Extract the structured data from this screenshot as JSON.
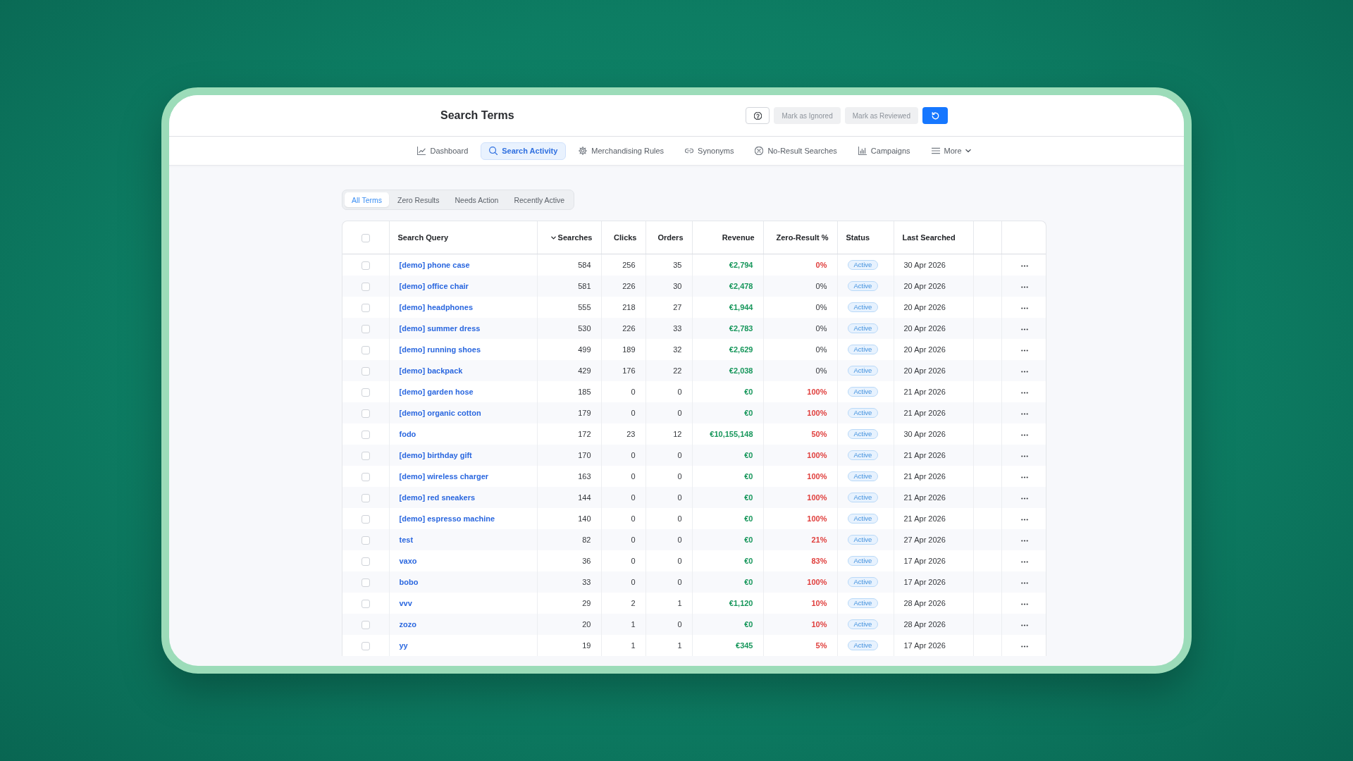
{
  "header": {
    "title": "Search Terms",
    "actions": [
      {
        "label": "Mark as Ignored",
        "disabled": true
      },
      {
        "label": "Mark as Reviewed",
        "disabled": true
      }
    ]
  },
  "nav": {
    "tabs": [
      {
        "label": "Dashboard",
        "selected": false
      },
      {
        "label": "Search Activity",
        "selected": true
      },
      {
        "label": "Merchandising Rules",
        "selected": false
      },
      {
        "label": "Synonyms",
        "selected": false
      },
      {
        "label": "No-Result Searches",
        "selected": false
      },
      {
        "label": "Campaigns",
        "selected": false
      }
    ],
    "more_menu": {
      "label": "More"
    }
  },
  "filters": [
    {
      "label": "All Terms",
      "selected": true
    },
    {
      "label": "Zero Results",
      "selected": false
    },
    {
      "label": "Needs Action",
      "selected": false
    },
    {
      "label": "Recently Active",
      "selected": false
    }
  ],
  "table": {
    "select_all": {
      "checked": false
    },
    "columns": [
      {
        "label": "Search Query",
        "sorted": false
      },
      {
        "label": "Searches",
        "sorted": true
      },
      {
        "label": "Clicks",
        "sorted": false
      },
      {
        "label": "Orders",
        "sorted": false
      },
      {
        "label": "Revenue",
        "sorted": false
      },
      {
        "label": "Zero-Result %",
        "sorted": false
      },
      {
        "label": "Status",
        "sorted": false
      },
      {
        "label": "Last Searched",
        "sorted": false
      }
    ],
    "rows": [
      {
        "checked": false,
        "query": "[demo] phone case",
        "searches": "584",
        "clicks": "256",
        "orders": "35",
        "revenue": "€2,794",
        "zero_result": "0%",
        "zero_result_alert": true,
        "status": "Active",
        "last_searched": "30 Apr 2026"
      },
      {
        "checked": false,
        "query": "[demo] office chair",
        "searches": "581",
        "clicks": "226",
        "orders": "30",
        "revenue": "€2,478",
        "zero_result": "0%",
        "zero_result_alert": false,
        "status": "Active",
        "last_searched": "20 Apr 2026"
      },
      {
        "checked": false,
        "query": "[demo] headphones",
        "searches": "555",
        "clicks": "218",
        "orders": "27",
        "revenue": "€1,944",
        "zero_result": "0%",
        "zero_result_alert": false,
        "status": "Active",
        "last_searched": "20 Apr 2026"
      },
      {
        "checked": false,
        "query": "[demo] summer dress",
        "searches": "530",
        "clicks": "226",
        "orders": "33",
        "revenue": "€2,783",
        "zero_result": "0%",
        "zero_result_alert": false,
        "status": "Active",
        "last_searched": "20 Apr 2026"
      },
      {
        "checked": false,
        "query": "[demo] running shoes",
        "searches": "499",
        "clicks": "189",
        "orders": "32",
        "revenue": "€2,629",
        "zero_result": "0%",
        "zero_result_alert": false,
        "status": "Active",
        "last_searched": "20 Apr 2026"
      },
      {
        "checked": false,
        "query": "[demo] backpack",
        "searches": "429",
        "clicks": "176",
        "orders": "22",
        "revenue": "€2,038",
        "zero_result": "0%",
        "zero_result_alert": false,
        "status": "Active",
        "last_searched": "20 Apr 2026"
      },
      {
        "checked": false,
        "query": "[demo] garden hose",
        "searches": "185",
        "clicks": "0",
        "orders": "0",
        "revenue": "€0",
        "zero_result": "100%",
        "zero_result_alert": true,
        "status": "Active",
        "last_searched": "21 Apr 2026"
      },
      {
        "checked": false,
        "query": "[demo] organic cotton",
        "searches": "179",
        "clicks": "0",
        "orders": "0",
        "revenue": "€0",
        "zero_result": "100%",
        "zero_result_alert": true,
        "status": "Active",
        "last_searched": "21 Apr 2026"
      },
      {
        "checked": false,
        "query": "fodo",
        "searches": "172",
        "clicks": "23",
        "orders": "12",
        "revenue": "€10,155,148",
        "zero_result": "50%",
        "zero_result_alert": true,
        "status": "Active",
        "last_searched": "30 Apr 2026"
      },
      {
        "checked": false,
        "query": "[demo] birthday gift",
        "searches": "170",
        "clicks": "0",
        "orders": "0",
        "revenue": "€0",
        "zero_result": "100%",
        "zero_result_alert": true,
        "status": "Active",
        "last_searched": "21 Apr 2026"
      },
      {
        "checked": false,
        "query": "[demo] wireless charger",
        "searches": "163",
        "clicks": "0",
        "orders": "0",
        "revenue": "€0",
        "zero_result": "100%",
        "zero_result_alert": true,
        "status": "Active",
        "last_searched": "21 Apr 2026"
      },
      {
        "checked": false,
        "query": "[demo] red sneakers",
        "searches": "144",
        "clicks": "0",
        "orders": "0",
        "revenue": "€0",
        "zero_result": "100%",
        "zero_result_alert": true,
        "status": "Active",
        "last_searched": "21 Apr 2026"
      },
      {
        "checked": false,
        "query": "[demo] espresso machine",
        "searches": "140",
        "clicks": "0",
        "orders": "0",
        "revenue": "€0",
        "zero_result": "100%",
        "zero_result_alert": true,
        "status": "Active",
        "last_searched": "21 Apr 2026"
      },
      {
        "checked": false,
        "query": "test",
        "searches": "82",
        "clicks": "0",
        "orders": "0",
        "revenue": "€0",
        "zero_result": "21%",
        "zero_result_alert": true,
        "status": "Active",
        "last_searched": "27 Apr 2026"
      },
      {
        "checked": false,
        "query": "vaxo",
        "searches": "36",
        "clicks": "0",
        "orders": "0",
        "revenue": "€0",
        "zero_result": "83%",
        "zero_result_alert": true,
        "status": "Active",
        "last_searched": "17 Apr 2026"
      },
      {
        "checked": false,
        "query": "bobo",
        "searches": "33",
        "clicks": "0",
        "orders": "0",
        "revenue": "€0",
        "zero_result": "100%",
        "zero_result_alert": true,
        "status": "Active",
        "last_searched": "17 Apr 2026"
      },
      {
        "checked": false,
        "query": "vvv",
        "searches": "29",
        "clicks": "2",
        "orders": "1",
        "revenue": "€1,120",
        "zero_result": "10%",
        "zero_result_alert": true,
        "status": "Active",
        "last_searched": "28 Apr 2026"
      },
      {
        "checked": false,
        "query": "zozo",
        "searches": "20",
        "clicks": "1",
        "orders": "0",
        "revenue": "€0",
        "zero_result": "10%",
        "zero_result_alert": true,
        "status": "Active",
        "last_searched": "28 Apr 2026"
      },
      {
        "checked": false,
        "query": "yy",
        "searches": "19",
        "clicks": "1",
        "orders": "1",
        "revenue": "€345",
        "zero_result": "5%",
        "zero_result_alert": true,
        "status": "Active",
        "last_searched": "17 Apr 2026"
      }
    ]
  }
}
